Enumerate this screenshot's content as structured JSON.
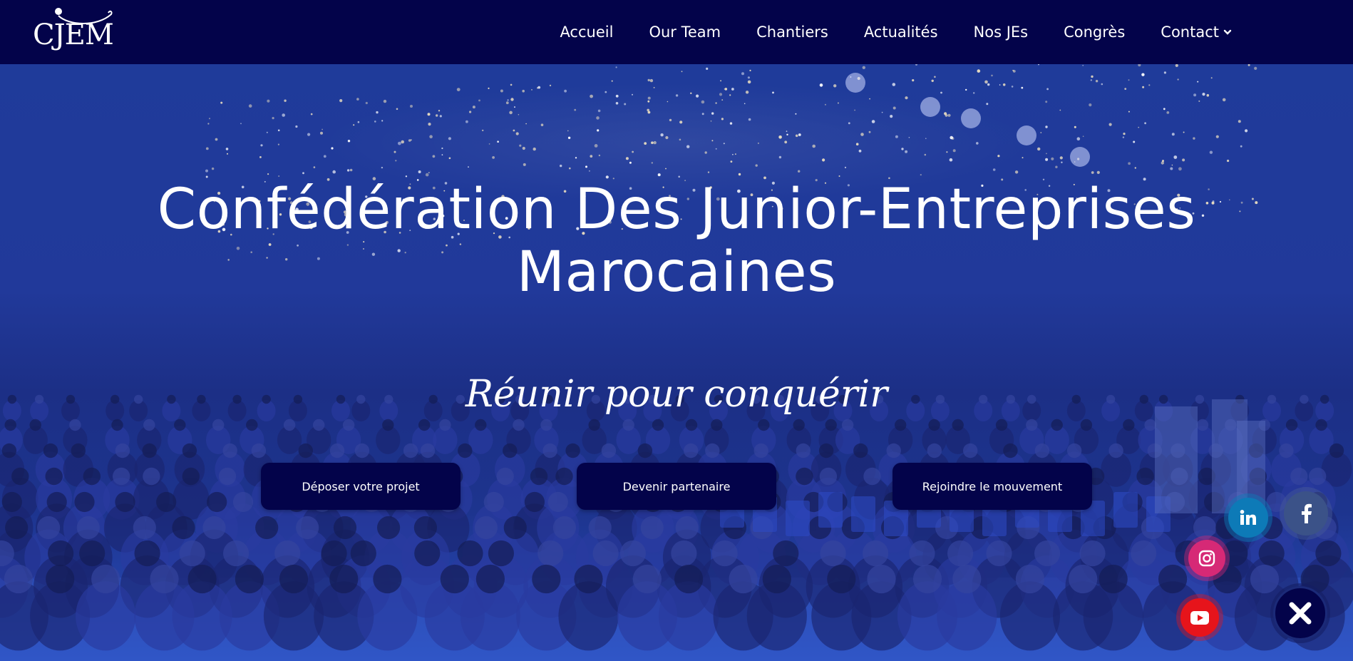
{
  "brand": {
    "logo_text": "CJEM"
  },
  "nav": {
    "items": [
      {
        "label": "Accueil"
      },
      {
        "label": "Our Team"
      },
      {
        "label": "Chantiers"
      },
      {
        "label": "Actualités"
      },
      {
        "label": "Nos JEs"
      },
      {
        "label": "Congrès"
      },
      {
        "label": "Contact",
        "has_dropdown": true
      }
    ]
  },
  "hero": {
    "title_line1": "Confédération Des Junior-Entreprises",
    "title_line2": "Marocaines",
    "slogan": "Réunir pour conquérir",
    "buttons": [
      {
        "label": "Déposer votre projet"
      },
      {
        "label": "Devenir partenaire"
      },
      {
        "label": "Rejoindre le mouvement"
      }
    ]
  },
  "social": {
    "items": [
      {
        "icon": "facebook-icon",
        "color": "#3b5288"
      },
      {
        "icon": "linkedin-icon",
        "color": "#0d7ab7"
      },
      {
        "icon": "instagram-icon",
        "color": "#d62976"
      },
      {
        "icon": "youtube-icon",
        "color": "#e6141b"
      }
    ],
    "close_icon": "close-icon"
  },
  "colors": {
    "nav_bg": "#03034a",
    "hero_overlay": "#21399a",
    "button_bg": "#03034a"
  }
}
